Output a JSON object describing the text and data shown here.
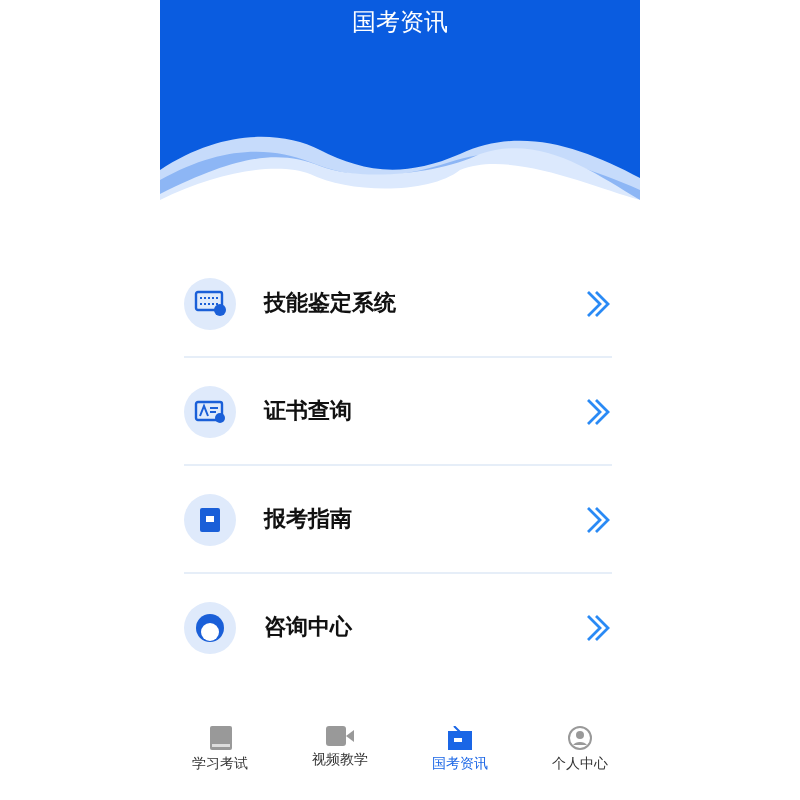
{
  "header": {
    "title": "国考资讯"
  },
  "menu": [
    {
      "kind": "keyboard",
      "label": "技能鉴定系统"
    },
    {
      "kind": "certificate",
      "label": "证书查询"
    },
    {
      "kind": "document",
      "label": "报考指南"
    },
    {
      "kind": "person",
      "label": "咨询中心"
    }
  ],
  "tab_bar": [
    {
      "kind": "book",
      "label": "学习考试",
      "selected": false
    },
    {
      "kind": "video",
      "label": "视频教学",
      "selected": false
    },
    {
      "kind": "news",
      "label": "国考资讯",
      "selected": true
    },
    {
      "kind": "user",
      "label": "个人中心",
      "selected": false
    }
  ]
}
